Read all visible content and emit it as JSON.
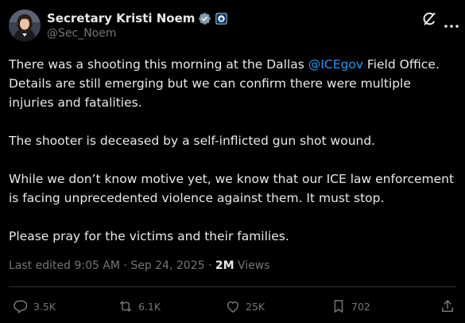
{
  "author": {
    "display_name": "Secretary Kristi Noem",
    "handle": "@Sec_Noem"
  },
  "tweet": {
    "p1_before": "There was a shooting this morning at the Dallas ",
    "p1_mention": "@ICEgov",
    "p1_after": " Field Office. Details are still emerging but we can confirm there were multiple injuries and fatalities.",
    "p2": "The shooter is deceased by a self-inflicted gun shot wound.",
    "p3": "While we don’t know motive yet, we know that our ICE law enforcement is facing unprecedented violence against them. It must stop.",
    "p4": "Please pray for the victims and their families."
  },
  "meta": {
    "edited_label": "Last edited 9:05 AM · Sep 24, 2025 · ",
    "views_count": "2M",
    "views_label": " Views"
  },
  "actions": {
    "replies": "3.5K",
    "reposts": "6.1K",
    "likes": "25K",
    "bookmarks": "702"
  },
  "icons": {
    "verified": "gray-verified-badge",
    "affiliate": "dhs-affiliate-badge",
    "grok": "grok-icon",
    "more": "more-dots-icon",
    "reply": "reply-icon",
    "repost": "repost-icon",
    "like": "heart-icon",
    "bookmark": "bookmark-icon",
    "share": "share-icon"
  },
  "colors": {
    "background": "#000000",
    "text": "#e7e9ea",
    "muted": "#71767b",
    "link": "#1d9bf0",
    "divider": "#2f3336",
    "verified_badge": "#829aab"
  }
}
